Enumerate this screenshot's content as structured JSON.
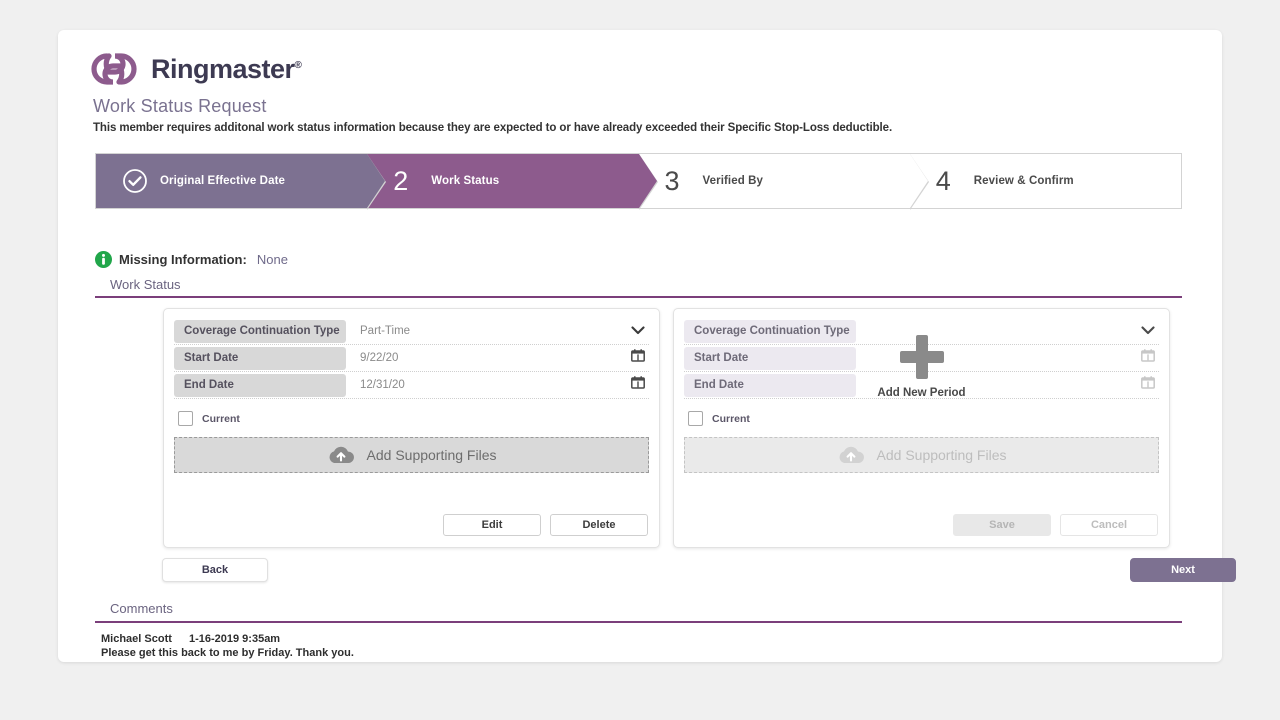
{
  "brand": {
    "name": "Ringmaster",
    "registered_mark": "®",
    "logo_icon": "interlocking-rings-logo",
    "accent_purple": "#8d5b8d",
    "muted_purple": "#7d7191",
    "rule_purple": "#7b3f7b"
  },
  "header": {
    "title": "Work Status Request",
    "subtitle": "This member requires additonal work status information because they are expected to or have already exceeded their Specific Stop-Loss deductible."
  },
  "stepper": {
    "steps": [
      {
        "number": "",
        "label": "Original Effective Date",
        "state": "done",
        "icon": "check-circle-icon"
      },
      {
        "number": "2",
        "label": "Work Status",
        "state": "active",
        "icon": ""
      },
      {
        "number": "3",
        "label": "Verified By",
        "state": "todo",
        "icon": ""
      },
      {
        "number": "4",
        "label": "Review & Confirm",
        "state": "todo",
        "icon": ""
      }
    ]
  },
  "missing_information": {
    "icon": "info-icon",
    "label": "Missing Information:",
    "value": "None"
  },
  "work_status_section": {
    "heading": "Work Status"
  },
  "existing_period": {
    "fields": [
      {
        "label": "Coverage Continuation Type",
        "value": "Part-Time",
        "icon": "chevron-down-icon"
      },
      {
        "label": "Start Date",
        "value": "9/22/20",
        "icon": "calendar-icon"
      },
      {
        "label": "End Date",
        "value": "12/31/20",
        "icon": "calendar-icon"
      }
    ],
    "current_checkbox_label": "Current",
    "current_checked": false,
    "upload_label": "Add Supporting Files",
    "upload_icon": "cloud-upload-icon",
    "buttons": [
      {
        "label": "Edit",
        "style": "outline"
      },
      {
        "label": "Delete",
        "style": "outline"
      }
    ]
  },
  "new_period": {
    "fields": [
      {
        "label": "Coverage Continuation Type",
        "value": "",
        "icon": "chevron-down-icon"
      },
      {
        "label": "Start Date",
        "value": "",
        "icon": "calendar-icon"
      },
      {
        "label": "End Date",
        "value": "",
        "icon": "calendar-icon"
      }
    ],
    "current_checkbox_label": "Current",
    "current_checked": false,
    "upload_label": "Add Supporting Files",
    "upload_icon": "cloud-upload-icon",
    "add_new_period_label": "Add New Period",
    "add_new_period_icon": "plus-icon",
    "buttons": [
      {
        "label": "Save",
        "style": "filled-disabled"
      },
      {
        "label": "Cancel",
        "style": "ghost"
      }
    ]
  },
  "navigation": {
    "back_label": "Back",
    "next_label": "Next"
  },
  "comments": {
    "heading": "Comments",
    "entries": [
      {
        "author": "Michael Scott",
        "timestamp": "1-16-2019 9:35am",
        "text": "Please get this back to me by Friday. Thank you."
      }
    ]
  }
}
